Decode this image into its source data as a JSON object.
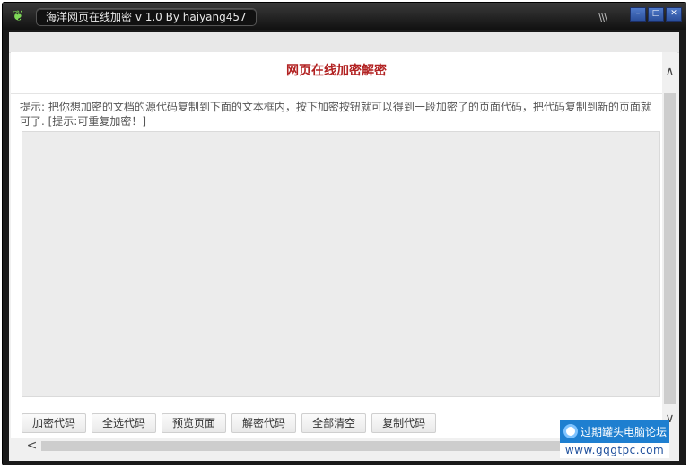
{
  "window": {
    "title": "海洋网页在线加密 v 1.0  By haiyang457",
    "app_icon": "leaf-icon",
    "grip": "\\\\\\",
    "controls": {
      "minimize": "–",
      "maximize": "□",
      "close": "✕"
    }
  },
  "page": {
    "heading": "网页在线加密解密",
    "hint": "提示: 把你想加密的文档的源代码复制到下面的文本框内，按下加密按钮就可以得到一段加密了的页面代码，把代码复制到新的页面就可了. [提示:可重复加密！]",
    "code_value": ""
  },
  "buttons": {
    "encrypt": "加密代码",
    "select_all": "全选代码",
    "preview": "预览页面",
    "decrypt": "解密代码",
    "clear_all": "全部清空",
    "copy": "复制代码"
  },
  "scroll": {
    "up": "∧",
    "down": "∨",
    "left": "<"
  },
  "watermark": {
    "text": "过期罐头电脑论坛",
    "url": "www.gqgtpc.com"
  },
  "colors": {
    "heading": "#b22222",
    "titlebar": "#1a1a1a",
    "watermark": "#1e7fd0"
  }
}
